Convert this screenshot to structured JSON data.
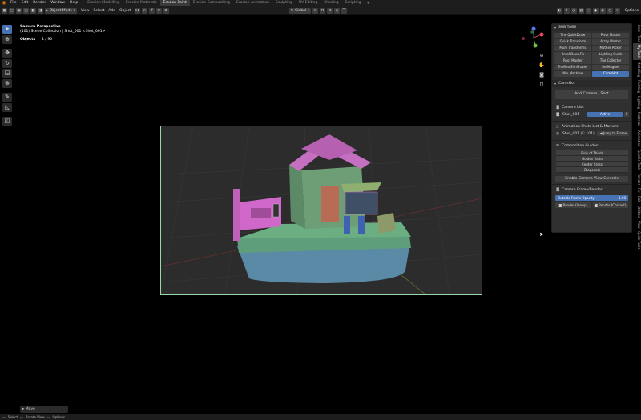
{
  "menubar": {
    "items": [
      "File",
      "Edit",
      "Render",
      "Window",
      "Help"
    ],
    "workspaces": [
      "Erosion Modelling",
      "Erosion Materials",
      "Erosion Paint",
      "Erosion Compositing",
      "Erosion Animation",
      "Sculpting",
      "UV Editing",
      "Shading",
      "Scripting"
    ],
    "active_workspace": "Erosion Paint"
  },
  "header": {
    "mode": "Object Mode",
    "menus": [
      "View",
      "Select",
      "Add",
      "Object"
    ],
    "transform_orientation": "Global",
    "options": "Options"
  },
  "viewport": {
    "perspective_label": "Camera Perspective",
    "collection_label": "(101) Scene Collection | Shot_001 <Shot_001>",
    "objects_label": "Objects",
    "objects_count": "1 / 90"
  },
  "npanel": {
    "subtabs_header": "SUB TABS",
    "subtabs": [
      "The QuickDraw",
      "Pivot Master",
      "Quick Transform",
      "Array Master",
      "Multi Transforms",
      "Mother Picker",
      "BrushDownFix",
      "Lighting Quick",
      "Roof Master",
      "The Collector",
      "TheRealSimShader",
      "RefMagnet",
      "Mix Machine",
      "CamsHot"
    ],
    "active_subtab": "CamsHot",
    "camshot_header": "CamsHot",
    "add_camera": "Add Camera / Shot",
    "camera_list_label": "Camera List:",
    "camera_entry": "Shot_001",
    "camera_active": "Active",
    "camera_remove": "X",
    "anim_label": "Animation Shots List & Markers:",
    "shot_entry": "Shot_001 (F: 101)",
    "jump_button": "Jump to Frame",
    "composition_label": "Composition Guides:",
    "guides": [
      "Rule of Thirds",
      "Golden Ratio",
      "Center Cross",
      "Diagonals"
    ],
    "enable_controls": "Enable Camera View Controls",
    "frame_render_label": "Camera Frame/Render:",
    "opacity_label": "Outside Frame Opacity",
    "opacity_value": "1.00",
    "render_viewport": "Render (Viewp)",
    "render_contact": "Render (Contact)"
  },
  "side_tabs": [
    "Item",
    "Tool",
    "My Tools",
    "Modelling",
    "Painting",
    "Lighting",
    "Materials",
    "Animation",
    "Quickie Tools",
    "Render",
    "Fix",
    "Edit",
    "Utilities",
    "View",
    "Quick Tools"
  ],
  "active_side_tab": "My Tools",
  "last_operator": "Move",
  "statusbar": {
    "items": [
      "Select",
      "Rotate View",
      "Options"
    ]
  },
  "colors": {
    "accent": "#4772b3",
    "frame_border": "#9ad9a0",
    "blender_orange": "#e87d0d"
  }
}
